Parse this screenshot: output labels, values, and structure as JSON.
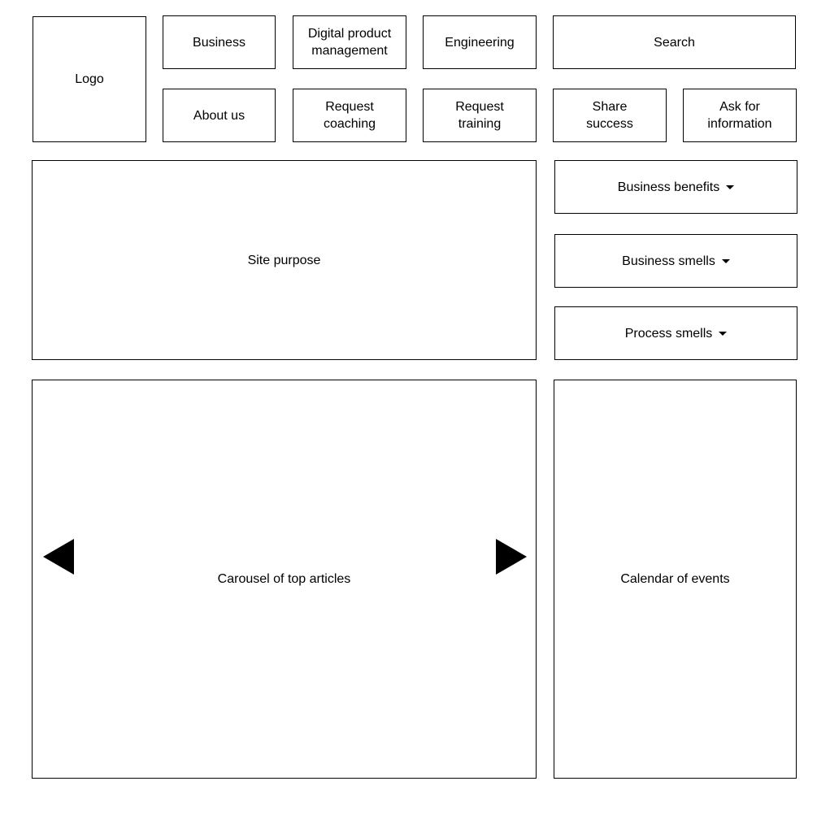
{
  "header": {
    "logo": "Logo",
    "nav_top": [
      "Business",
      "Digital product\nmanagement",
      "Engineering"
    ],
    "search": "Search",
    "nav_bottom": [
      "About us",
      "Request\ncoaching",
      "Request\ntraining",
      "Share\nsuccess",
      "Ask for\ninformation"
    ]
  },
  "main": {
    "site_purpose": "Site purpose",
    "dropdowns": [
      {
        "label": "Business benefits",
        "icon": "caret-down-icon"
      },
      {
        "label": "Business smells",
        "icon": "caret-down-icon"
      },
      {
        "label": "Process smells",
        "icon": "caret-down-icon"
      }
    ],
    "carousel": {
      "label": "Carousel of top articles",
      "prev_icon": "triangle-left-icon",
      "next_icon": "triangle-right-icon"
    },
    "calendar": "Calendar of events"
  }
}
